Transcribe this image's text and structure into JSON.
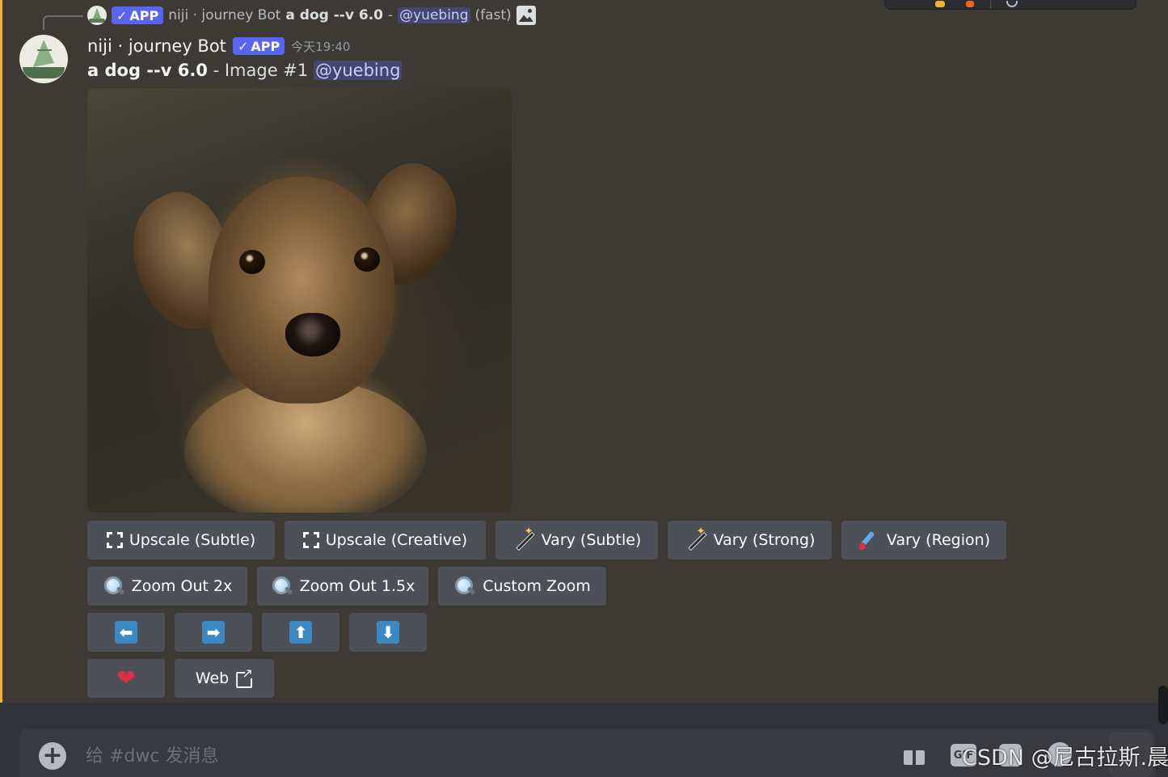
{
  "reply": {
    "bot_name": "niji · journey Bot",
    "badge": "APP",
    "prompt": "a dog --v 6.0",
    "dash": "-",
    "mention": "@yuebing",
    "speed": "(fast)"
  },
  "message": {
    "author": "niji · journey Bot",
    "badge": "APP",
    "timestamp": "今天19:40",
    "prompt": "a dog --v 6.0",
    "suffix": " - Image #1 ",
    "mention": "@yuebing"
  },
  "buttons": {
    "row1": [
      "Upscale (Subtle)",
      "Upscale (Creative)",
      "Vary (Subtle)",
      "Vary (Strong)",
      "Vary (Region)"
    ],
    "row2": [
      "Zoom Out 2x",
      "Zoom Out 1.5x",
      "Custom Zoom"
    ],
    "arrows": [
      "⬅",
      "➡",
      "⬆",
      "⬇"
    ],
    "web": "Web"
  },
  "input": {
    "placeholder": "给 #dwc 发消息",
    "gif_label": "GIF"
  },
  "watermark": "CSDN @尼古拉斯.晨",
  "colors": {
    "background": "#3d3a35",
    "highlight": "#f0b132",
    "button": "#4e5058",
    "app_badge": "#5865f2",
    "input_panel": "#313338"
  },
  "icons": [
    "expand-icon",
    "magic-wand-icon",
    "paintbrush-icon",
    "magnifier-icon",
    "arrow-icon",
    "heart-icon",
    "external-link-icon",
    "plus-icon",
    "gift-icon",
    "gif-icon",
    "sticker-icon",
    "emoji-icon"
  ]
}
